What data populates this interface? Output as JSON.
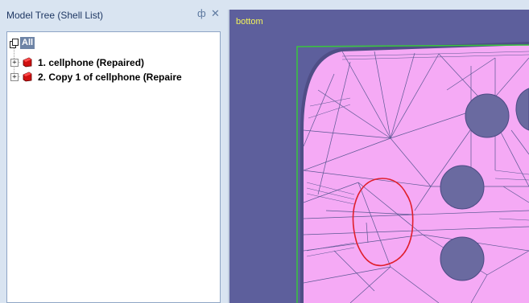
{
  "panel": {
    "title": "Model Tree (Shell List)",
    "pin_icon": "pin-icon",
    "close_icon": "close-icon",
    "pin_glyph": "ф",
    "close_glyph": "✕"
  },
  "tree": {
    "root_label": "All",
    "items": [
      {
        "label": "1. cellphone (Repaired)",
        "icon": "shell-icon"
      },
      {
        "label": "2. Copy 1 of cellphone (Repaire",
        "icon": "shell-icon"
      }
    ]
  },
  "viewport": {
    "view_name": "bottom",
    "colors": {
      "background": "#5d5f9c",
      "mesh_fill": "#f5aaf5",
      "mesh_lines": "#5b5893",
      "selection_box": "#39c63c",
      "highlight": "#e01e2b",
      "label": "#f3f35a"
    }
  }
}
